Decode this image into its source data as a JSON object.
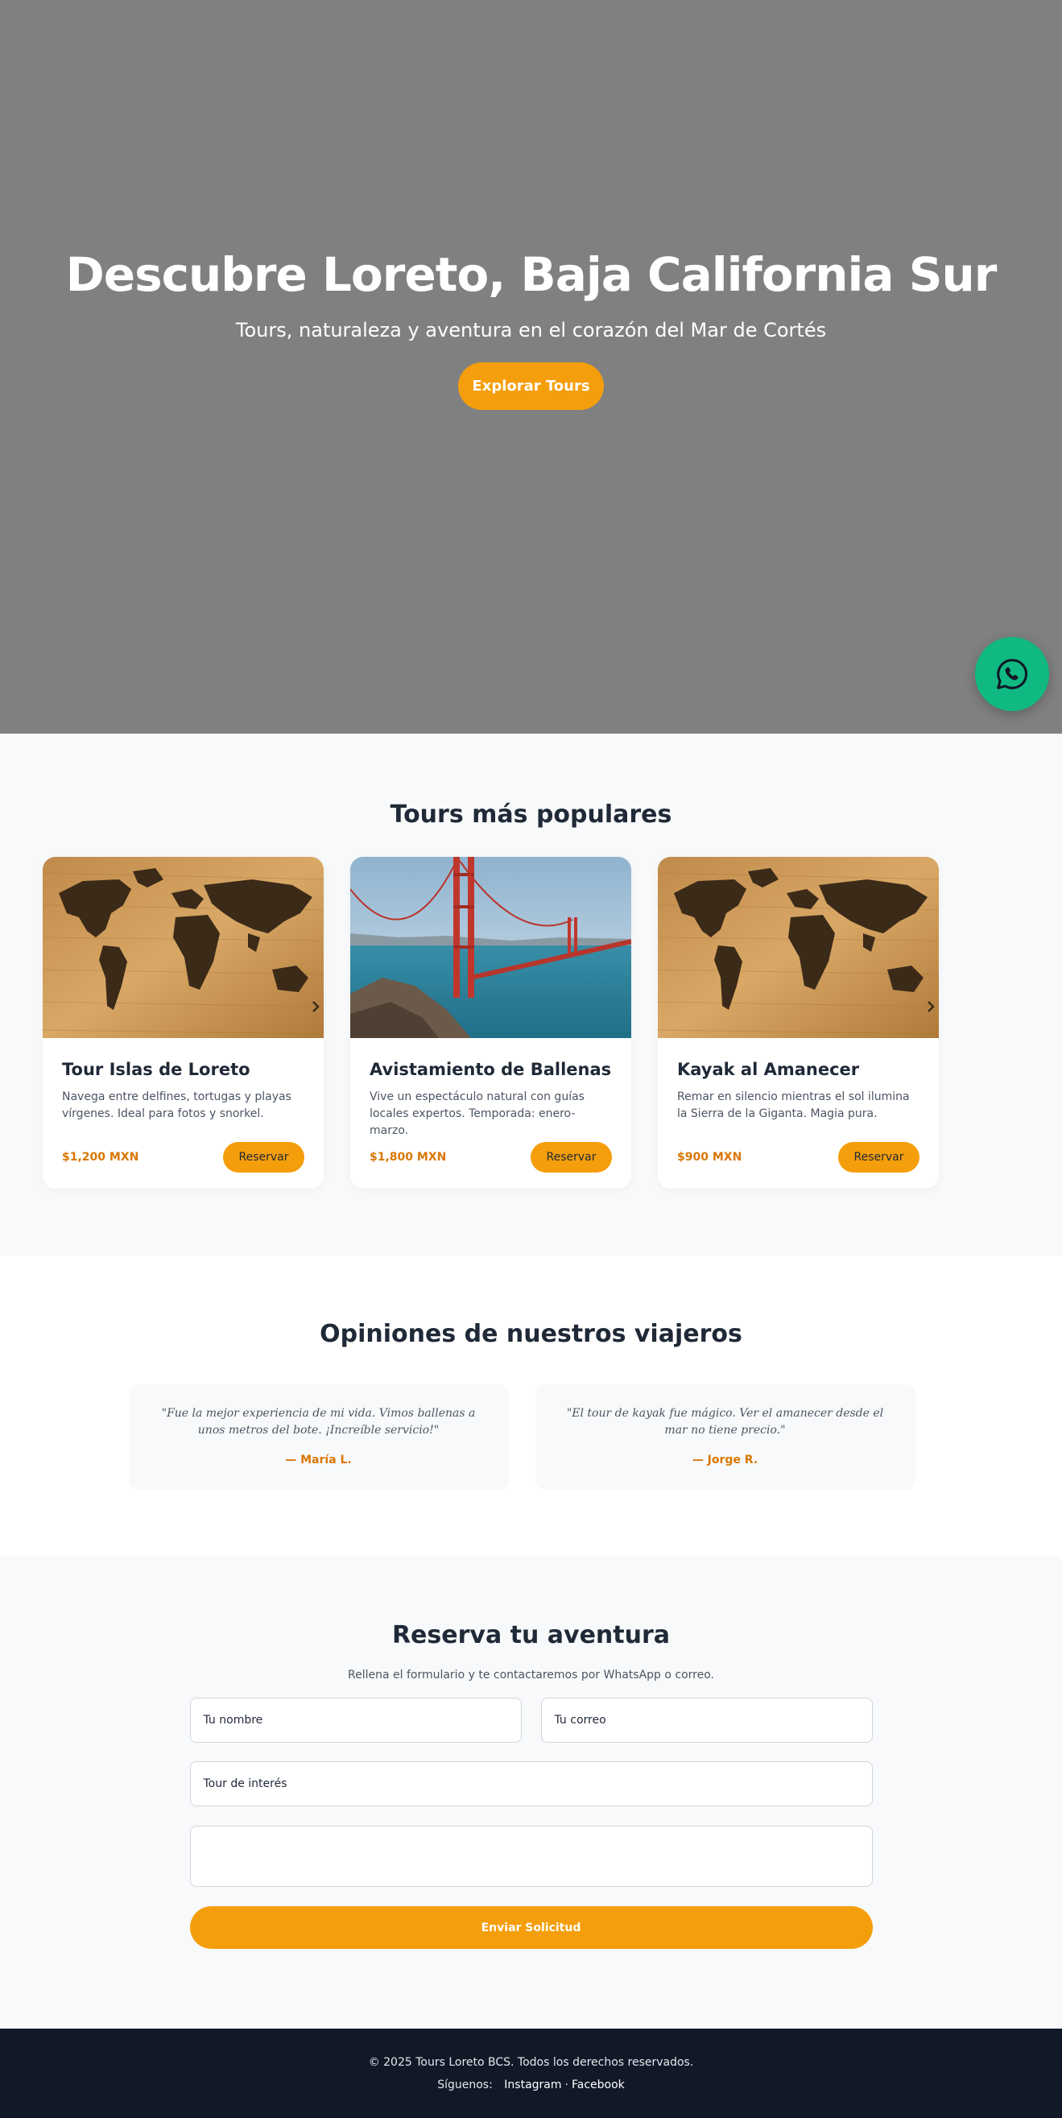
{
  "hero": {
    "title": "Descubre Loreto, Baja California Sur",
    "subtitle": "Tours, naturaleza y aventura en el corazón del Mar de Cortés",
    "cta_label": "Explorar Tours"
  },
  "whatsapp": {
    "icon": "whatsapp-icon",
    "color": "#10b981"
  },
  "tours": {
    "title": "Tours más populares",
    "items": [
      {
        "title": "Tour Islas de Loreto",
        "description": "Navega entre delfines, tortugas y playas vírgenes. Ideal para fotos y snorkel.",
        "price": "$1,200 MXN",
        "button": "Reservar",
        "image": "world-map-on-wood"
      },
      {
        "title": "Avistamiento de Ballenas",
        "description": "Vive un espectáculo natural con guías locales expertos. Temporada: enero-marzo.",
        "price": "$1,800 MXN",
        "button": "Reservar",
        "image": "golden-gate-bridge"
      },
      {
        "title": "Kayak al Amanecer",
        "description": "Remar en silencio mientras el sol ilumina la Sierra de la Giganta. Magia pura.",
        "price": "$900 MXN",
        "button": "Reservar",
        "image": "world-map-on-wood"
      }
    ]
  },
  "testimonials": {
    "title": "Opiniones de nuestros viajeros",
    "items": [
      {
        "quote": "\"Fue la mejor experiencia de mi vida. Vimos ballenas a unos metros del bote. ¡Increíble servicio!\"",
        "author": "— María L."
      },
      {
        "quote": "\"El tour de kayak fue mágico. Ver el amanecer desde el mar no tiene precio.\"",
        "author": "— Jorge R."
      }
    ]
  },
  "booking": {
    "title": "Reserva tu aventura",
    "lead": "Rellena el formulario y te contactaremos por WhatsApp o correo.",
    "name_placeholder": "Tu nombre",
    "email_placeholder": "Tu correo",
    "tour_placeholder": "Tour de interés",
    "message_placeholder": "",
    "submit_label": "Enviar Solicitud"
  },
  "footer": {
    "copyright": "© 2025 Tours Loreto BCS. Todos los derechos reservados.",
    "follow": "Síguenos:",
    "links": [
      "Instagram",
      "Facebook"
    ],
    "separator": "·"
  },
  "colors": {
    "accent": "#f59e0b",
    "accent_text": "#d97706",
    "footer_bg": "#111827",
    "hero_bg": "#808080"
  }
}
